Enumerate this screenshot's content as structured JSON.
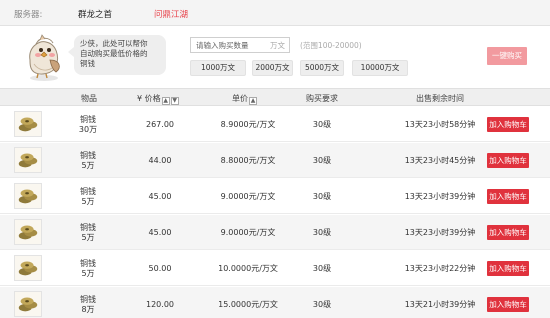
{
  "server": {
    "label": "服务器:",
    "name": "群龙之首",
    "zone": "问鼎江湖"
  },
  "helper": {
    "tip_line1": "少侠，此处可以帮你",
    "tip_line2": "自动购买最低价格的",
    "tip_line3": "铜钱",
    "qty_placeholder": "请输入购买数量",
    "qty_unit": "万文",
    "qty_range": "(范围100-20000)",
    "presets": [
      "1000万文",
      "2000万文",
      "5000万文",
      "10000万文"
    ],
    "buy_label": "一键购买"
  },
  "table": {
    "headers": {
      "item": "物品",
      "price": "¥ 价格",
      "unit_price": "单价",
      "requirement": "购买要求",
      "time_left": "出售剩余时间"
    },
    "cart_label": "加入购物车",
    "rows": [
      {
        "name": "铜钱",
        "amount": "30万",
        "price": "267.00",
        "unit_price": "8.9000元/万文",
        "requirement": "30级",
        "time_left": "13天23小时58分钟"
      },
      {
        "name": "铜钱",
        "amount": "5万",
        "price": "44.00",
        "unit_price": "8.8000元/万文",
        "requirement": "30级",
        "time_left": "13天23小时45分钟"
      },
      {
        "name": "铜钱",
        "amount": "5万",
        "price": "45.00",
        "unit_price": "9.0000元/万文",
        "requirement": "30级",
        "time_left": "13天23小时39分钟"
      },
      {
        "name": "铜钱",
        "amount": "5万",
        "price": "45.00",
        "unit_price": "9.0000元/万文",
        "requirement": "30级",
        "time_left": "13天23小时39分钟"
      },
      {
        "name": "铜钱",
        "amount": "5万",
        "price": "50.00",
        "unit_price": "10.0000元/万文",
        "requirement": "30级",
        "time_left": "13天23小时22分钟"
      },
      {
        "name": "铜钱",
        "amount": "8万",
        "price": "120.00",
        "unit_price": "15.0000元/万文",
        "requirement": "30级",
        "time_left": "13天21小时39分钟"
      }
    ]
  },
  "colors": {
    "accent_red": "#e0323d",
    "zone_red": "#e8434b",
    "buy_disabled": "#f29a9f"
  }
}
